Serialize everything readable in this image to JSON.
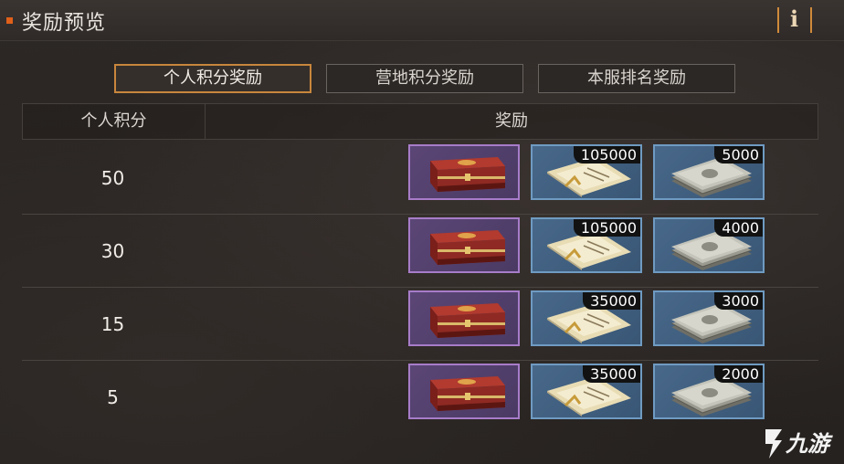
{
  "header": {
    "title": "奖励预览",
    "info_icon": "info-icon",
    "info_glyph": "i",
    "accent": "#e0601a"
  },
  "tabs": [
    {
      "label": "个人积分奖励",
      "active": true
    },
    {
      "label": "营地积分奖励",
      "active": false
    },
    {
      "label": "本服排名奖励",
      "active": false
    }
  ],
  "table": {
    "columns": [
      "个人积分",
      "奖励"
    ],
    "rows": [
      {
        "score": "50",
        "rewards": [
          {
            "icon": "red-chest-icon",
            "qty": ""
          },
          {
            "icon": "paper-voucher-icon",
            "qty": "105000"
          },
          {
            "icon": "cash-stack-icon",
            "qty": "5000"
          }
        ]
      },
      {
        "score": "30",
        "rewards": [
          {
            "icon": "red-chest-icon",
            "qty": ""
          },
          {
            "icon": "paper-voucher-icon",
            "qty": "105000"
          },
          {
            "icon": "cash-stack-icon",
            "qty": "4000"
          }
        ]
      },
      {
        "score": "15",
        "rewards": [
          {
            "icon": "red-chest-icon",
            "qty": ""
          },
          {
            "icon": "paper-voucher-icon",
            "qty": "35000"
          },
          {
            "icon": "cash-stack-icon",
            "qty": "3000"
          }
        ]
      },
      {
        "score": "5",
        "rewards": [
          {
            "icon": "red-chest-icon",
            "qty": ""
          },
          {
            "icon": "paper-voucher-icon",
            "qty": "35000"
          },
          {
            "icon": "cash-stack-icon",
            "qty": "2000"
          }
        ]
      }
    ]
  },
  "watermark": {
    "text": "九游",
    "icon": "jiuyou-logo-icon"
  },
  "colors": {
    "tab_active_border": "#c8863c",
    "chest_frame": "#a77cc9",
    "item_frame": "#6f9bc2"
  }
}
